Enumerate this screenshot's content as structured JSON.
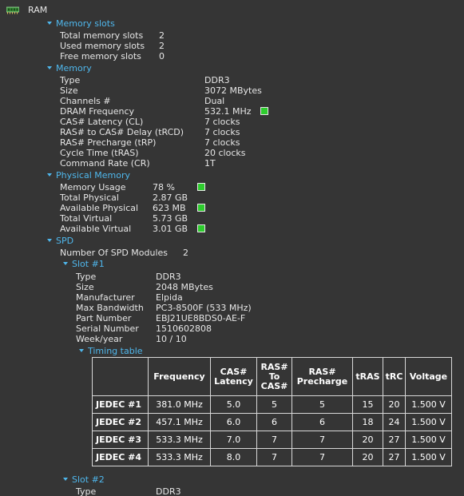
{
  "root": {
    "label": "RAM",
    "icon": "memory-chip-icon"
  },
  "memory_slots": {
    "header": "Memory slots",
    "rows": [
      {
        "label": "Total memory slots",
        "value": "2"
      },
      {
        "label": "Used memory slots",
        "value": "2"
      },
      {
        "label": "Free memory slots",
        "value": "0"
      }
    ]
  },
  "memory": {
    "header": "Memory",
    "rows": [
      {
        "label": "Type",
        "value": "DDR3"
      },
      {
        "label": "Size",
        "value": "3072 MBytes"
      },
      {
        "label": "Channels #",
        "value": "Dual"
      },
      {
        "label": "DRAM Frequency",
        "value": "532.1 MHz"
      },
      {
        "label": "CAS# Latency (CL)",
        "value": "7 clocks"
      },
      {
        "label": "RAS# to CAS# Delay (tRCD)",
        "value": "7 clocks"
      },
      {
        "label": "RAS# Precharge (tRP)",
        "value": "7 clocks"
      },
      {
        "label": "Cycle Time (tRAS)",
        "value": "20 clocks"
      },
      {
        "label": "Command Rate (CR)",
        "value": "1T"
      }
    ]
  },
  "physical_memory": {
    "header": "Physical Memory",
    "rows": [
      {
        "label": "Memory Usage",
        "value": "78 %"
      },
      {
        "label": "Total Physical",
        "value": "2.87 GB"
      },
      {
        "label": "Available Physical",
        "value": "623 MB"
      },
      {
        "label": "Total Virtual",
        "value": "5.73 GB"
      },
      {
        "label": "Available Virtual",
        "value": "3.01 GB"
      }
    ]
  },
  "spd": {
    "header": "SPD",
    "modules_label": "Number Of SPD Modules",
    "modules_value": "2",
    "slot1": {
      "header": "Slot #1",
      "rows": [
        {
          "label": "Type",
          "value": "DDR3"
        },
        {
          "label": "Size",
          "value": "2048 MBytes"
        },
        {
          "label": "Manufacturer",
          "value": "Elpida"
        },
        {
          "label": "Max Bandwidth",
          "value": "PC3-8500F (533 MHz)"
        },
        {
          "label": "Part Number",
          "value": "EBJ21UE8BDS0-AE-F"
        },
        {
          "label": "Serial Number",
          "value": "1510602808"
        },
        {
          "label": "Week/year",
          "value": "10 / 10"
        }
      ],
      "timing_table": {
        "header": "Timing table",
        "columns": [
          "Frequency",
          "CAS# Latency",
          "RAS# To CAS#",
          "RAS# Precharge",
          "tRAS",
          "tRC",
          "Voltage"
        ],
        "rows": [
          {
            "name": "JEDEC #1",
            "cells": [
              "381.0 MHz",
              "5.0",
              "5",
              "5",
              "15",
              "20",
              "1.500 V"
            ]
          },
          {
            "name": "JEDEC #2",
            "cells": [
              "457.1 MHz",
              "6.0",
              "6",
              "6",
              "18",
              "24",
              "1.500 V"
            ]
          },
          {
            "name": "JEDEC #3",
            "cells": [
              "533.3 MHz",
              "7.0",
              "7",
              "7",
              "20",
              "27",
              "1.500 V"
            ]
          },
          {
            "name": "JEDEC #4",
            "cells": [
              "533.3 MHz",
              "8.0",
              "7",
              "7",
              "20",
              "27",
              "1.500 V"
            ]
          }
        ]
      }
    },
    "slot2": {
      "header": "Slot #2",
      "rows": [
        {
          "label": "Type",
          "value": "DDR3"
        }
      ]
    }
  },
  "colors": {
    "background": "#353535",
    "section_header": "#4fb7ec",
    "text": "#e6e6e6",
    "indicator": "#2ecc2e"
  }
}
